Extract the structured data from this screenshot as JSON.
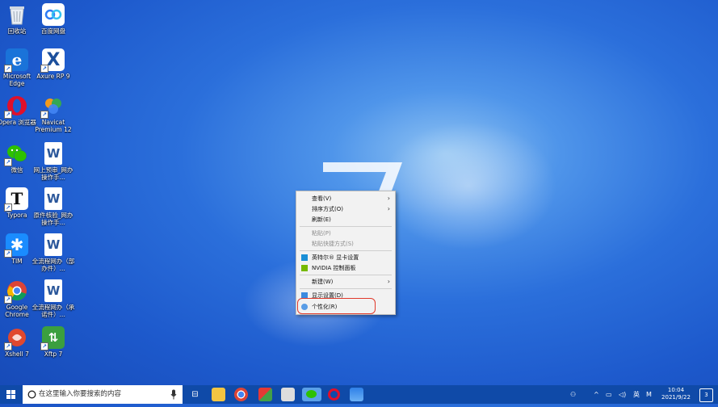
{
  "desktop_icons": [
    {
      "label": "回收站",
      "icon": "recycle-bin-icon"
    },
    {
      "label": "百度网盘",
      "icon": "baidu-netdisk-icon"
    },
    {
      "label": "Microsoft Edge",
      "icon": "edge-icon"
    },
    {
      "label": "Axure RP 9",
      "icon": "axure-icon"
    },
    {
      "label": "Opera 浏览器",
      "icon": "opera-icon"
    },
    {
      "label": "Navicat Premium 12",
      "icon": "navicat-icon"
    },
    {
      "label": "微信",
      "icon": "wechat-icon"
    },
    {
      "label": "网上预审_网办操作手...",
      "icon": "word-doc-icon"
    },
    {
      "label": "Typora",
      "icon": "typora-icon"
    },
    {
      "label": "原件核验_网办操作手...",
      "icon": "word-doc-icon"
    },
    {
      "label": "TIM",
      "icon": "tim-icon"
    },
    {
      "label": "全流程网办（部办件）...",
      "icon": "word-doc-icon"
    },
    {
      "label": "Google Chrome",
      "icon": "chrome-icon"
    },
    {
      "label": "全流程网办（承诺件）...",
      "icon": "word-doc-icon"
    },
    {
      "label": "Xshell 7",
      "icon": "xshell-icon"
    },
    {
      "label": "Xftp 7",
      "icon": "xftp-icon"
    }
  ],
  "context_menu": {
    "view": "查看(V)",
    "sort": "排序方式(O)",
    "refresh": "刷新(E)",
    "paste": "粘贴(P)",
    "paste_shortcut": "粘贴快捷方式(S)",
    "intel_graphics": "英特尔® 显卡设置",
    "nvidia": "NVIDIA 控制面板",
    "new": "新建(W)",
    "display": "显示设置(D)",
    "personalize": "个性化(R)"
  },
  "taskbar": {
    "search_placeholder": "在这里输入你要搜索的内容",
    "tray_ime": "英",
    "tray_m": "M",
    "time": "10:04",
    "date": "2021/9/22",
    "notification_count": "3"
  },
  "colors": {
    "taskbar": "#0f4aa8",
    "highlight": "#e0392b"
  }
}
